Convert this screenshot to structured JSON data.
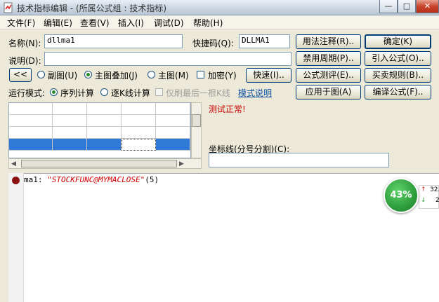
{
  "window": {
    "title": "技术指标编辑 - (所属公式组 : 技术指标)",
    "min_label": "—",
    "max_label": "□",
    "close_label": "✕"
  },
  "menu": [
    {
      "label": "文件(F)"
    },
    {
      "label": "编辑(E)"
    },
    {
      "label": "查看(V)"
    },
    {
      "label": "插入(I)"
    },
    {
      "label": "调试(D)"
    },
    {
      "label": "帮助(H)"
    }
  ],
  "form": {
    "name_label": "名称(N):",
    "name_value": "dllma1",
    "shortcut_label": "快捷码(Q):",
    "shortcut_value": "DLLMA1",
    "desc_label": "说明(D):",
    "desc_value": ""
  },
  "buttons": {
    "usage_note": "用法注释(R)..",
    "confirm": "确定(K)",
    "disabled_period": "禁用周期(P)..",
    "import_formula": "引入公式(O)..",
    "formula_test": "公式测评(E)..",
    "trade_rules": "买卖规则(B)..",
    "apply_to_chart": "应用于图(A)",
    "compile_formula": "编译公式(F)..",
    "collapse": "<<",
    "quick": "快速(I).."
  },
  "display": {
    "sub_chart": "副图(U)",
    "main_overlay": "主图叠加(J)",
    "main_chart": "主图(M)",
    "encrypt": "加密(Y)",
    "selected": "main_overlay"
  },
  "run_mode": {
    "label": "运行模式:",
    "sequential": "序列计算",
    "per_kline": "逐K线计算",
    "only_last": "仅刷最后一根K线",
    "mode_link": "模式说明",
    "selected": "sequential"
  },
  "status": {
    "message": "测试正常!",
    "message_color": "#cc0000"
  },
  "coord": {
    "label": "坐标线(分号分割)(C):",
    "value": ""
  },
  "code": {
    "var_name": "ma1:",
    "string_literal": "\"STOCKFUNC@MYMACLOSE\"",
    "args": "(5)"
  },
  "widget": {
    "percent": "43%",
    "up_value": "32.",
    "down_value": "2"
  },
  "colors": {
    "accent": "#1c5180",
    "link": "#0b4fa3",
    "error": "#cc0000",
    "badge": "#2e9e3c"
  }
}
